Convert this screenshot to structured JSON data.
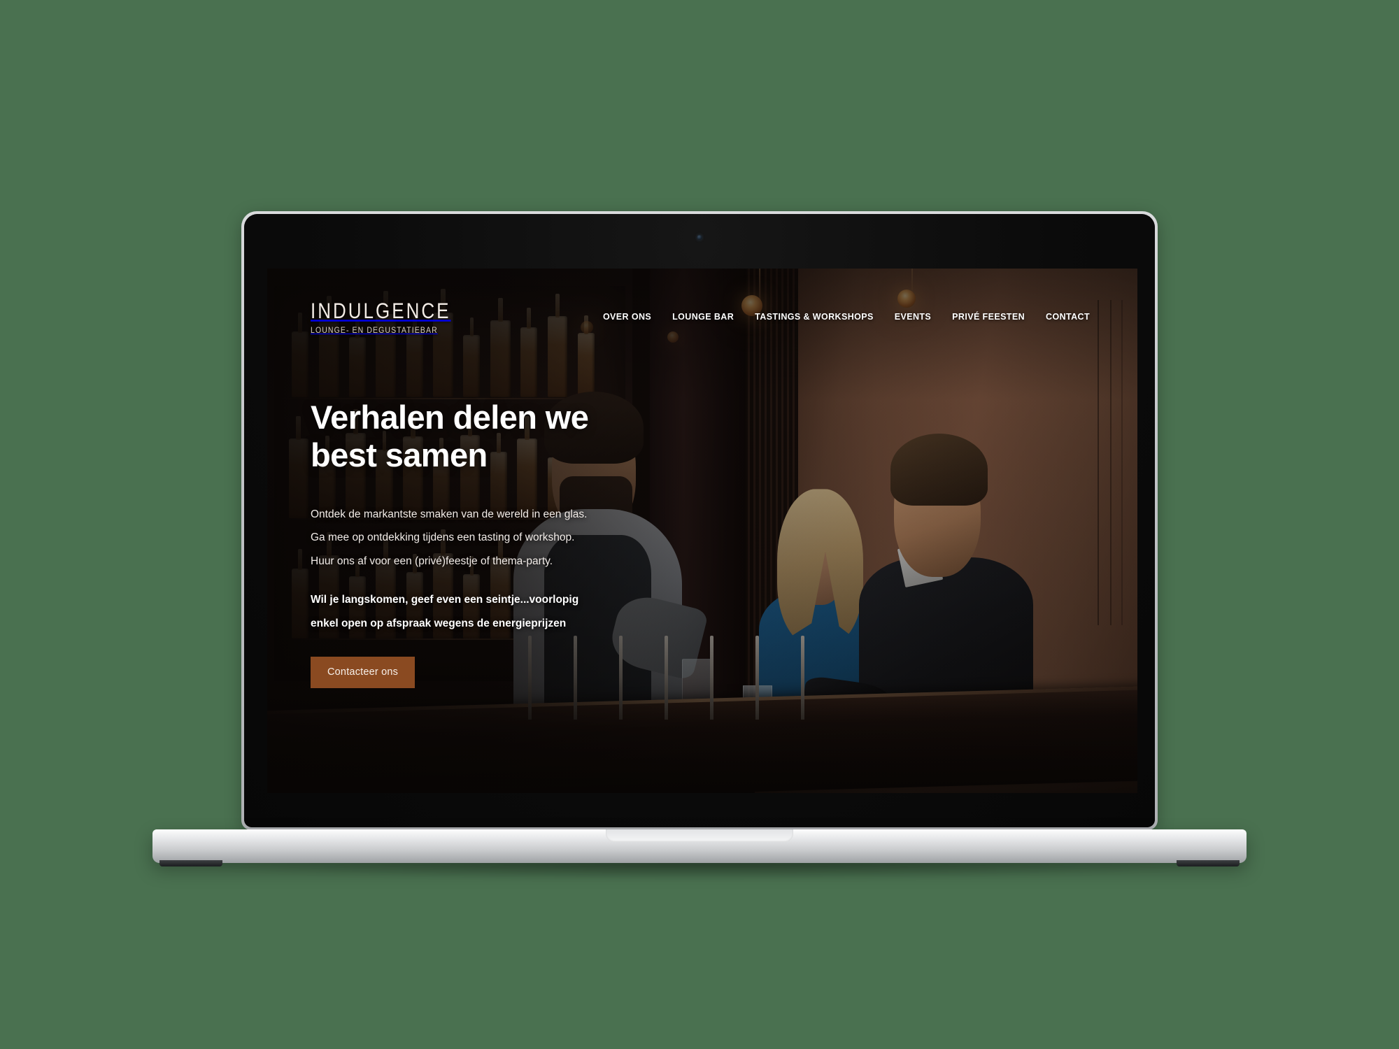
{
  "background": {
    "color": "#4a7150"
  },
  "device": {
    "type": "laptop-mockup",
    "camera_label": "webcam"
  },
  "site": {
    "logo": {
      "name": "INDULGENCE",
      "subtitle": "LOUNGE- EN DEGUSTATIEBAR"
    },
    "nav": [
      {
        "label": "OVER ONS"
      },
      {
        "label": "LOUNGE BAR"
      },
      {
        "label": "TASTINGS & WORKSHOPS"
      },
      {
        "label": "EVENTS"
      },
      {
        "label": "PRIVÉ FEESTEN"
      },
      {
        "label": "CONTACT"
      }
    ],
    "hero": {
      "title": "Verhalen delen we\nbest samen",
      "lines": [
        "Ontdek de markantste smaken van de wereld in een glas.",
        "Ga mee op ontdekking tijdens een tasting of workshop.",
        "Huur ons af voor een (privé)feestje of thema-party."
      ],
      "notice": [
        "Wil je langskomen, geef even een seintje...voorlopig",
        "enkel open op afspraak wegens de energieprijzen"
      ],
      "cta_label": "Contacteer ons",
      "cta_color": "#8a4a21",
      "background_scene": "bar interior with bartender pouring a drink and two guests seated at the counter"
    }
  }
}
